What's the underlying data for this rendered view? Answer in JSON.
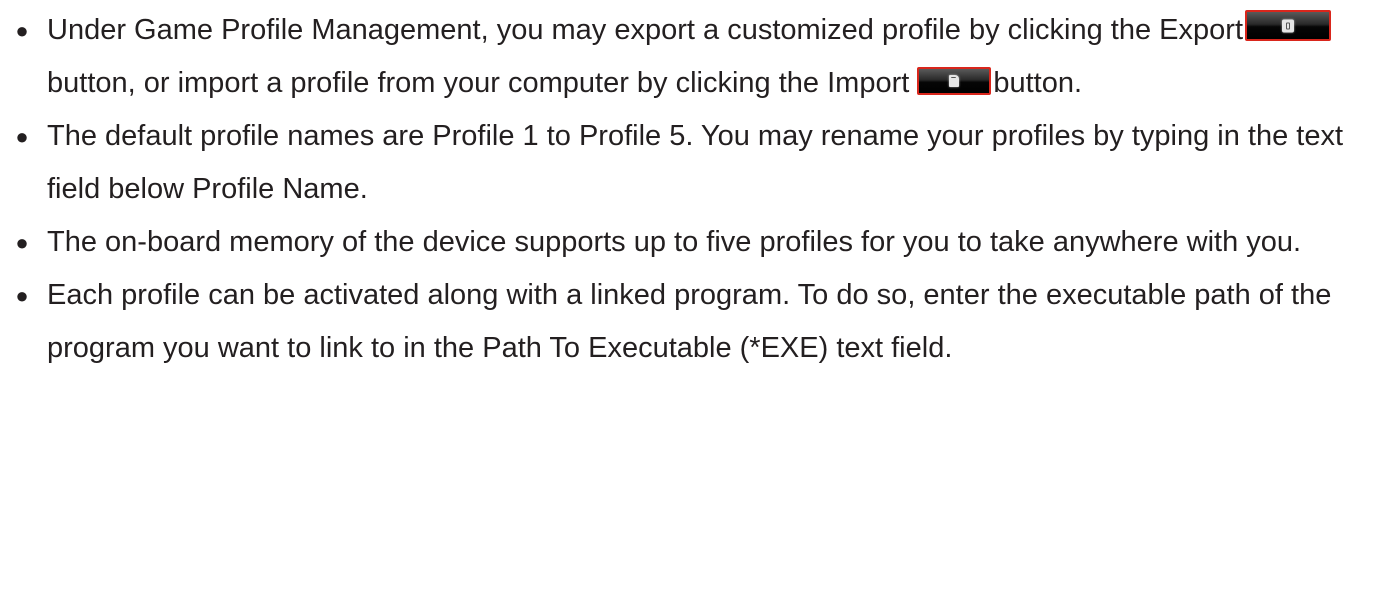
{
  "items": [
    {
      "part1": "Under Game Profile Management, you may export a customized profile by clicking the Export",
      "part2": " button, or import a profile from your computer by clicking the Import ",
      "part3": "button."
    },
    {
      "text": "The default profile names are Profile 1 to Profile 5. You may rename your profiles by typing in the text field below Profile Name."
    },
    {
      "text": "The on-board memory of the device supports up to five profiles for you to take anywhere with you."
    },
    {
      "text": "Each profile can be activated along with a linked program. To do so, enter the executable path of the program you want to link to in the Path To Executable (*EXE) text field."
    }
  ],
  "icons": {
    "export": "export-button-icon",
    "import": "import-button-icon"
  },
  "colors": {
    "text": "#231f20",
    "button_border": "#d9261c",
    "button_fill": "#000000"
  }
}
